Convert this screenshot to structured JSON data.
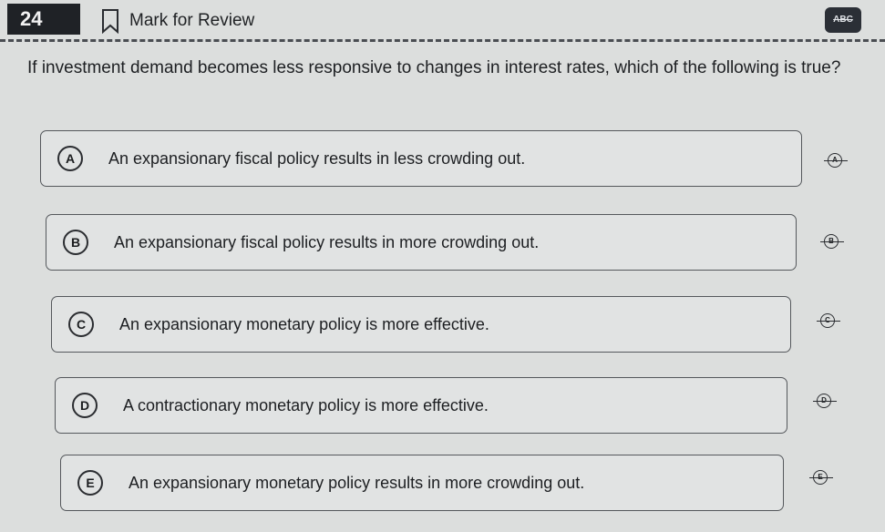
{
  "header": {
    "question_number": "24",
    "mark_for_review_label": "Mark for Review",
    "abc_button_label": "ABC"
  },
  "question": {
    "text": "If investment demand becomes less responsive to changes in interest rates, which of the following is true?"
  },
  "options": [
    {
      "letter": "A",
      "text": "An expansionary fiscal policy results in less crowding out."
    },
    {
      "letter": "B",
      "text": "An expansionary fiscal policy results in more crowding out."
    },
    {
      "letter": "C",
      "text": "An expansionary monetary policy is more effective."
    },
    {
      "letter": "D",
      "text": "A contractionary monetary policy is more effective."
    },
    {
      "letter": "E",
      "text": "An expansionary monetary policy results in more crowding out."
    }
  ],
  "icons": {
    "bookmark": "bookmark-icon",
    "cross_out": "cross-out-icon"
  }
}
